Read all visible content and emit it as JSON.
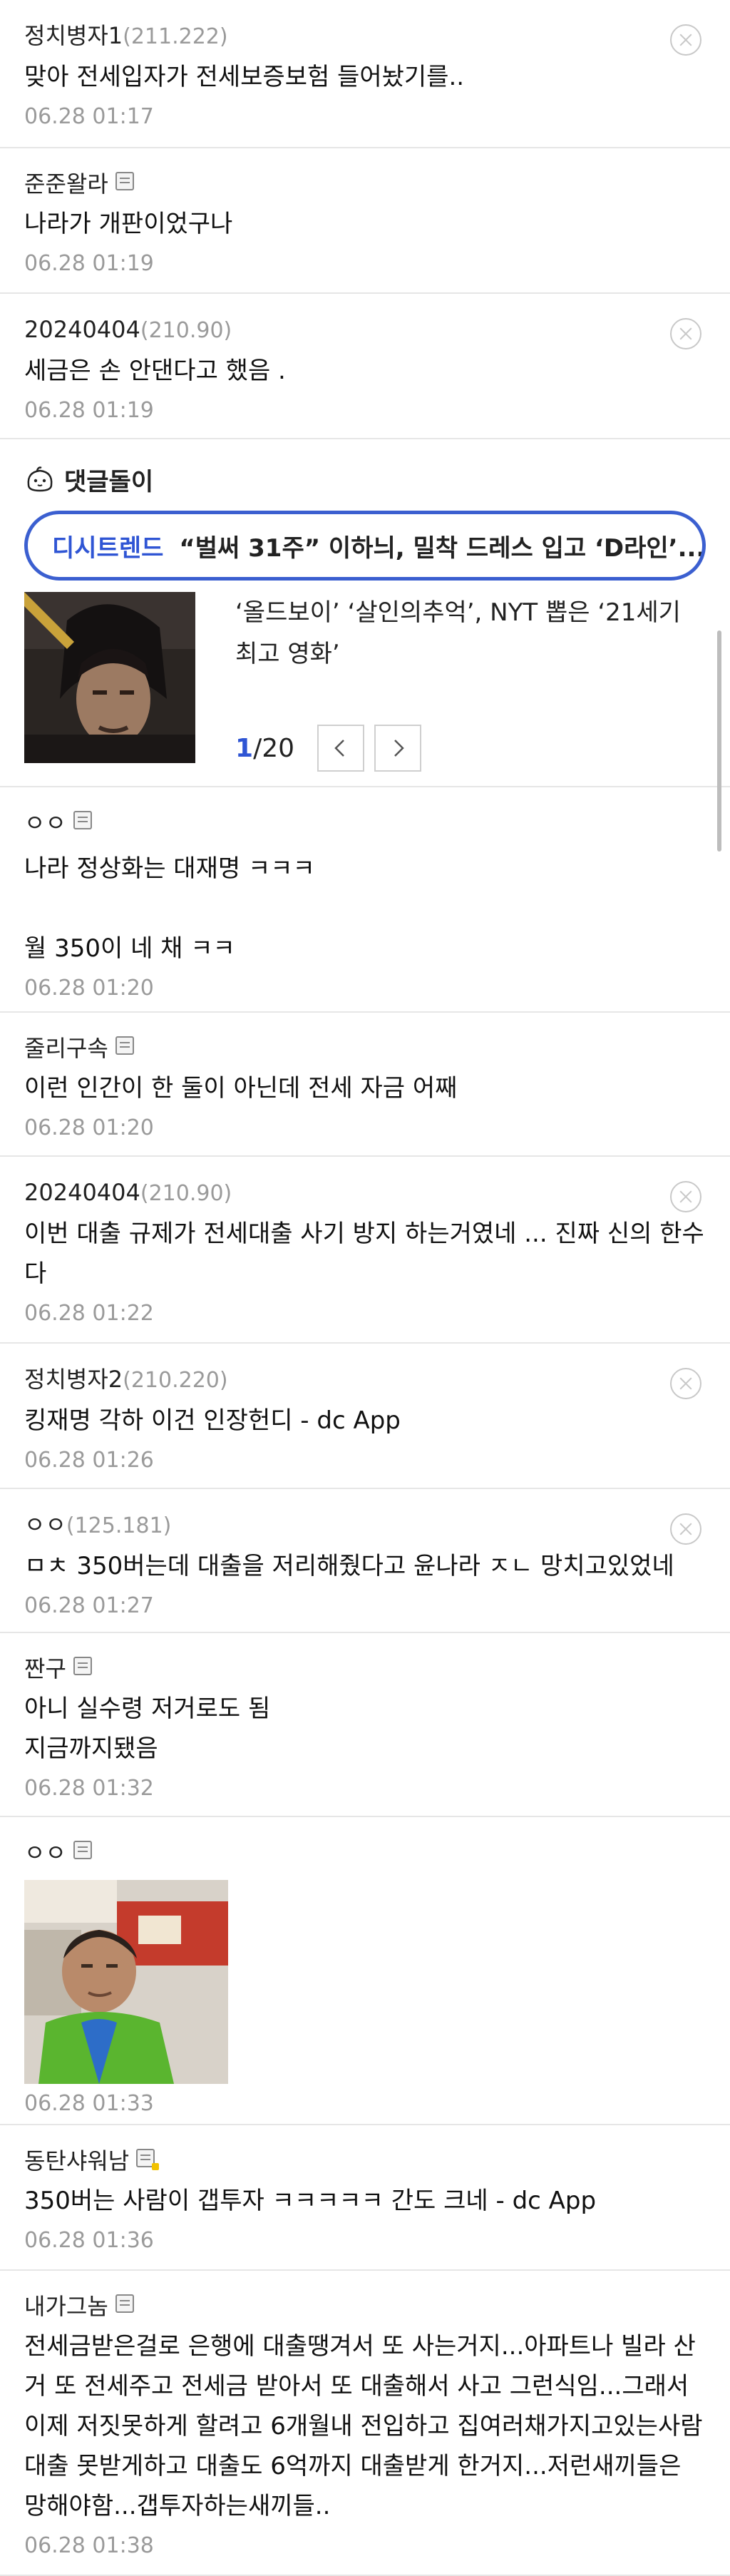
{
  "comments_top": [
    {
      "author": "정치병자1",
      "ip": "(211.222)",
      "has_memo": false,
      "text": "맞아 전세입자가 전세보증보험 들어놨기를..",
      "date": "06.28 01:17",
      "deletable": true
    },
    {
      "author": "준준왈라",
      "ip": "",
      "has_memo": true,
      "text": "나라가 개판이었구나",
      "date": "06.28 01:19",
      "deletable": false
    },
    {
      "author": "20240404",
      "ip": "(210.90)",
      "has_memo": false,
      "text": "세금은 손 안댄다고 했음 .",
      "date": "06.28 01:19",
      "deletable": true
    }
  ],
  "promo": {
    "bot_label": "댓글돌이",
    "trend_tag": "디시트렌드",
    "trend_headline": "“벌써 31주” 이하늬, 밀착 드레스 입고 ‘D라인’...",
    "title": "‘올드보이’ ‘살인의추억’, NYT 뽑은 ‘21세기 최고 영화’",
    "page_current": "1",
    "page_total": "/20"
  },
  "comments_bottom": [
    {
      "author": "ㅇㅇ",
      "ip": "",
      "has_memo": true,
      "text": "나라 정상화는 대재명 ㅋㅋㅋ\n\n월 350이 네 채 ㅋㅋ",
      "date": "06.28 01:20",
      "deletable": false
    },
    {
      "author": "줄리구속",
      "ip": "",
      "has_memo": true,
      "text": "이런 인간이 한 둘이 아닌데 전세 자금 어째",
      "date": "06.28 01:20",
      "deletable": false
    },
    {
      "author": "20240404",
      "ip": "(210.90)",
      "has_memo": false,
      "text": "이번 대출 규제가 전세대출 사기 방지 하는거였네 ... 진짜 신의 한수다",
      "date": "06.28 01:22",
      "deletable": true
    },
    {
      "author": "정치병자2",
      "ip": "(210.220)",
      "has_memo": false,
      "text": "킹재명 각하 이건 인장헌디 - dc App",
      "date": "06.28 01:26",
      "deletable": true
    },
    {
      "author": "ㅇㅇ",
      "ip": "(125.181)",
      "has_memo": false,
      "text": "ㅁㅊ 350버는데 대출을 저리해줬다고 윤나라 ㅈㄴ 망치고있었네",
      "date": "06.28 01:27",
      "deletable": true
    },
    {
      "author": "짠구",
      "ip": "",
      "has_memo": true,
      "text": "아니 실수령 저거로도 됨\n지금까지됐음",
      "date": "06.28 01:32",
      "deletable": false
    },
    {
      "author": "ㅇㅇ",
      "ip": "",
      "has_memo": true,
      "text": "",
      "date": "06.28 01:33",
      "deletable": false,
      "has_image": true
    },
    {
      "author": "동탄샤워남",
      "ip": "",
      "has_memo": true,
      "memo_mobile": true,
      "text": "350버는 사람이 갭투자 ㅋㅋㅋㅋㅋ 간도 크네 - dc App",
      "date": "06.28 01:36",
      "deletable": false
    },
    {
      "author": "내가그놈",
      "ip": "",
      "has_memo": true,
      "text": "전세금받은걸로 은행에 대출땡겨서 또 사는거지...아파트나 빌라 산거 또 전세주고 전세금 받아서 또 대출해서 사고 그런식임...그래서 이제 저짓못하게 할려고 6개월내 전입하고 집여러채가지고있는사람 대출 못받게하고 대출도 6억까지 대출받게 한거지...저런새끼들은 망해야함...갭투자하는새끼들..",
      "date": "06.28 01:38",
      "deletable": false
    }
  ]
}
